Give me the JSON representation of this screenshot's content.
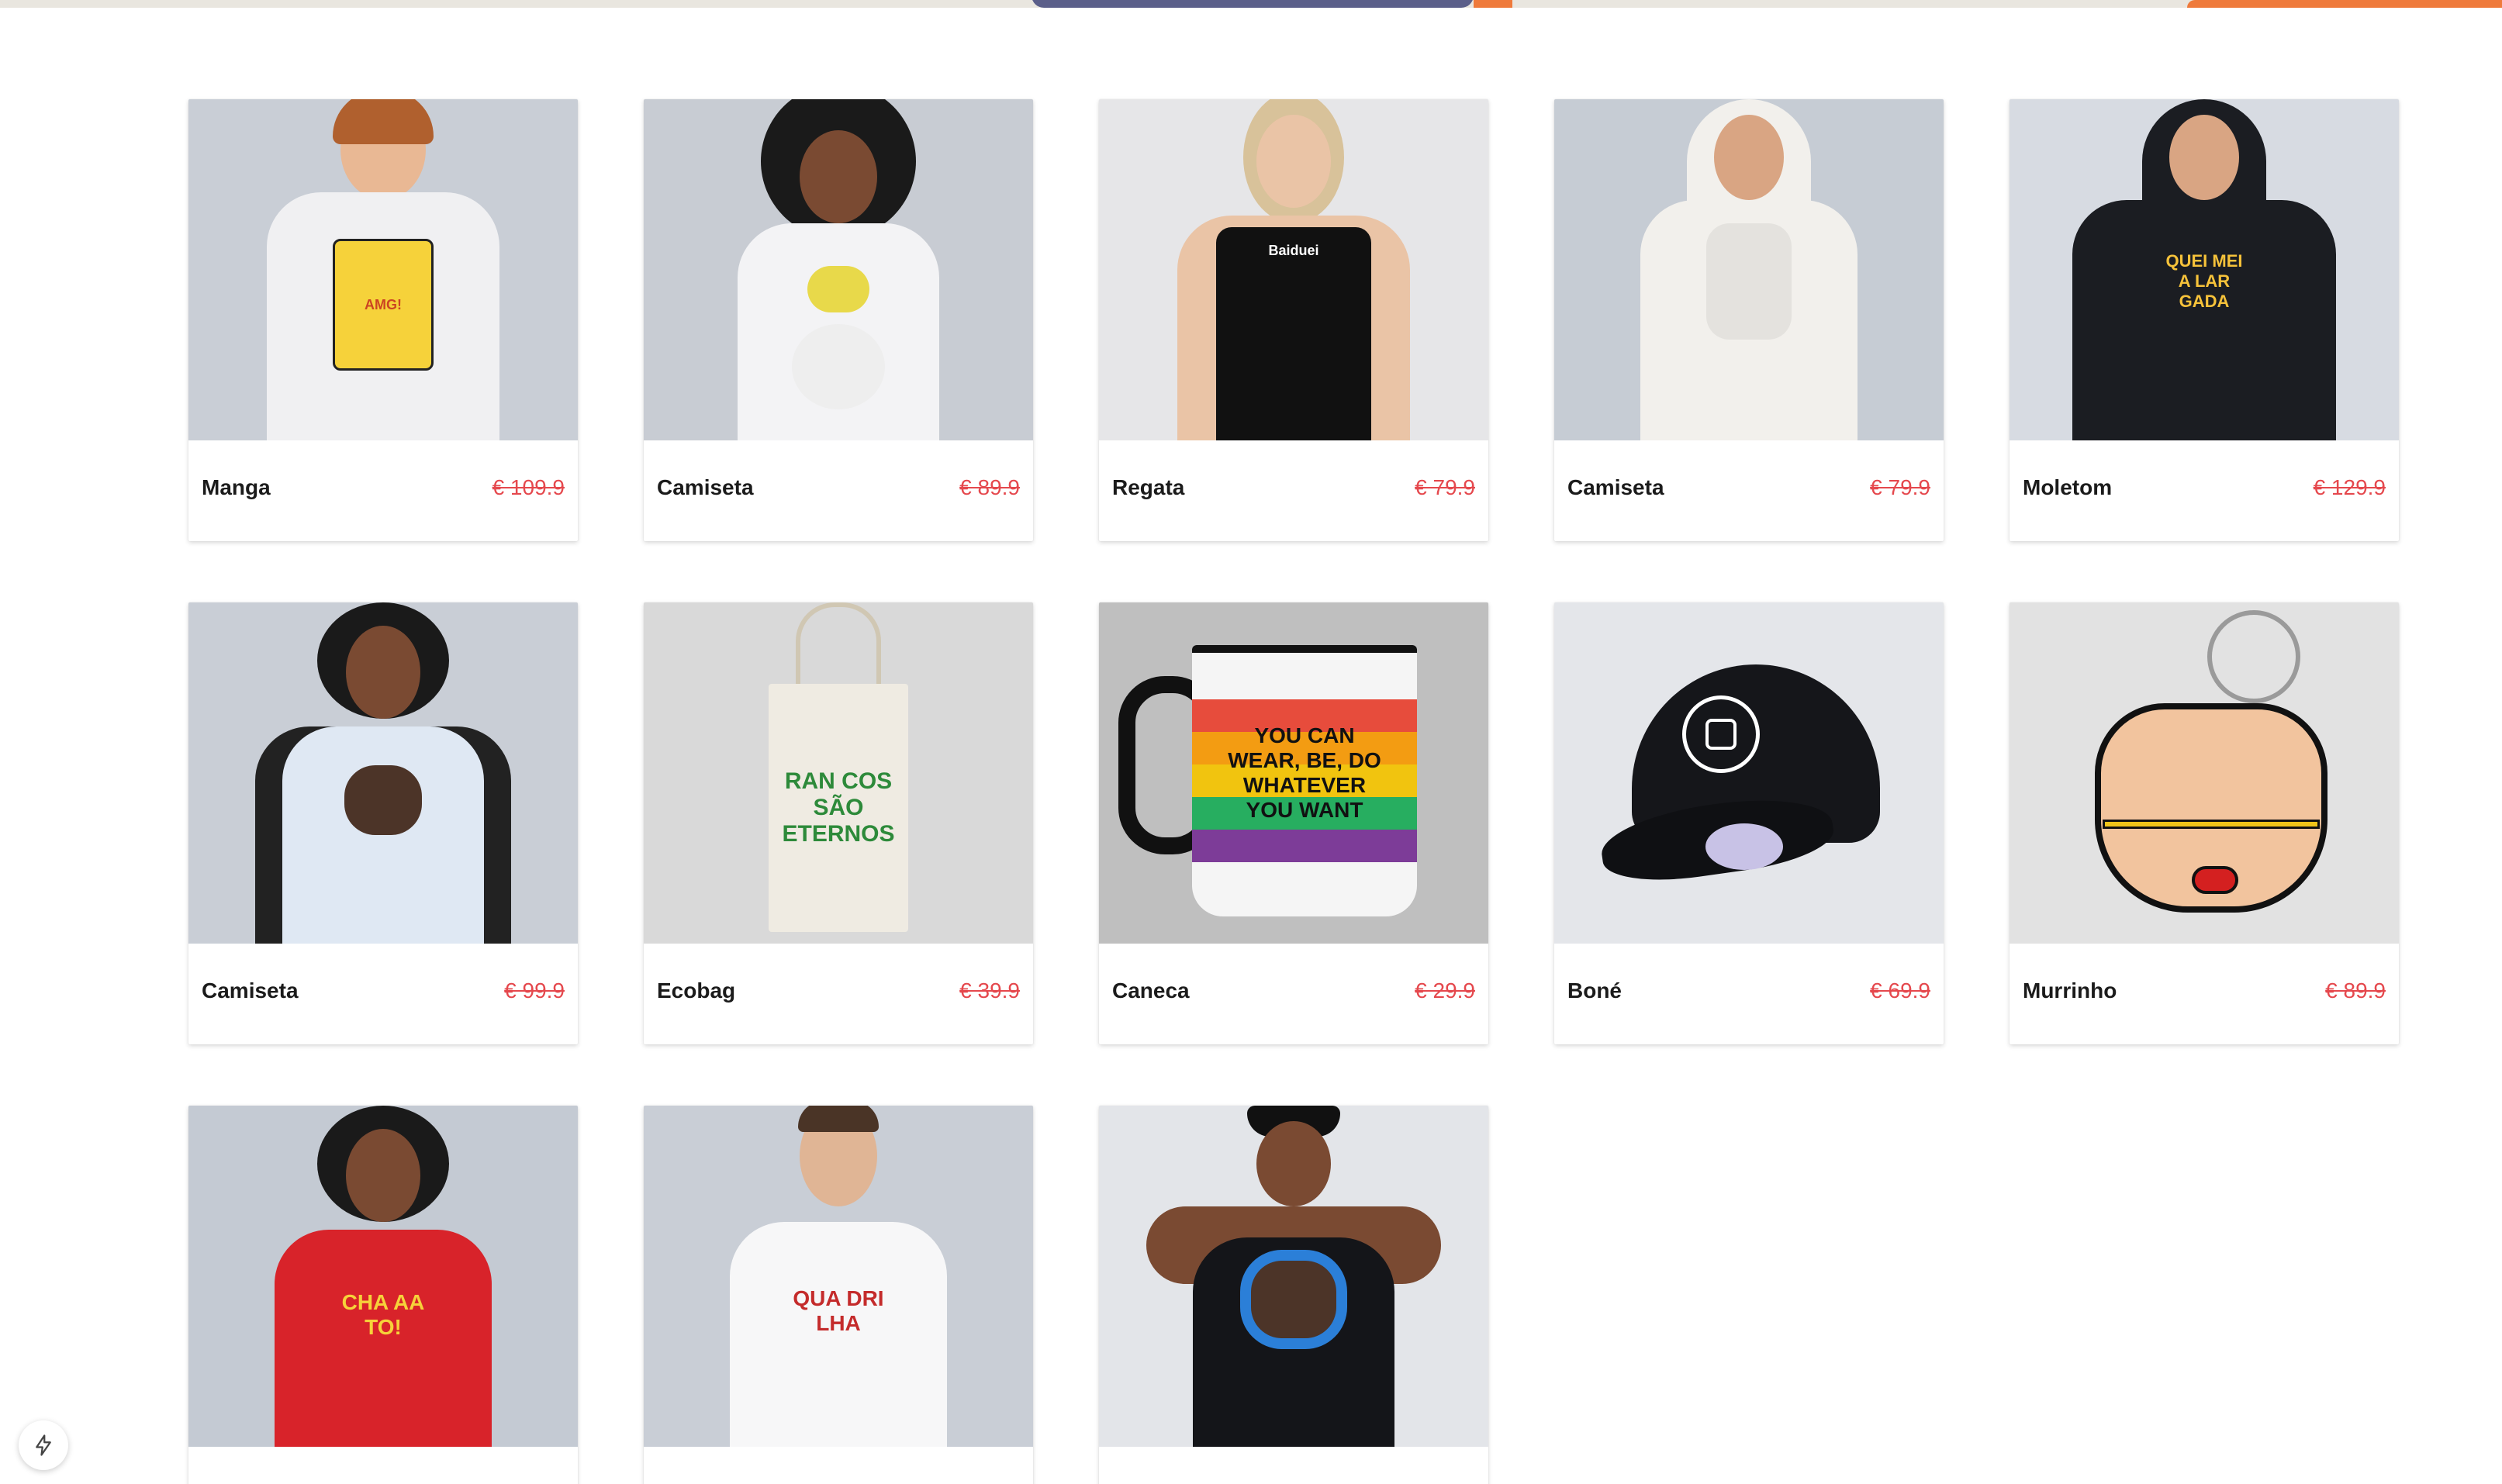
{
  "products": [
    {
      "name": "Manga",
      "price": "€ 109.9"
    },
    {
      "name": "Camiseta",
      "price": "€ 89.9"
    },
    {
      "name": "Regata",
      "price": "€ 79.9"
    },
    {
      "name": "Camiseta",
      "price": "€ 79.9"
    },
    {
      "name": "Moletom",
      "price": "€ 129.9"
    },
    {
      "name": "Camiseta",
      "price": "€ 99.9"
    },
    {
      "name": "Ecobag",
      "price": "€ 39.9"
    },
    {
      "name": "Caneca",
      "price": "€ 29.9"
    },
    {
      "name": "Boné",
      "price": "€ 69.9"
    },
    {
      "name": "Murrinho",
      "price": "€ 89.9"
    },
    {
      "name": "",
      "price": ""
    },
    {
      "name": "",
      "price": ""
    },
    {
      "name": "",
      "price": ""
    }
  ],
  "prints": {
    "mug": "YOU CAN WEAR, BE, DO WHATEVER YOU WANT",
    "bag": "RAN COS SÃO ETERNOS",
    "hoodie": "QUEI MEI A LAR GADA",
    "tank": "Baiduei",
    "red_tee": "CHA AA TO!",
    "white_tee": "QUA DRI LHA"
  },
  "icons": {
    "fab": "bolt-icon"
  },
  "colors": {
    "price": "#e5484d",
    "accent": "#ef7a3b"
  }
}
